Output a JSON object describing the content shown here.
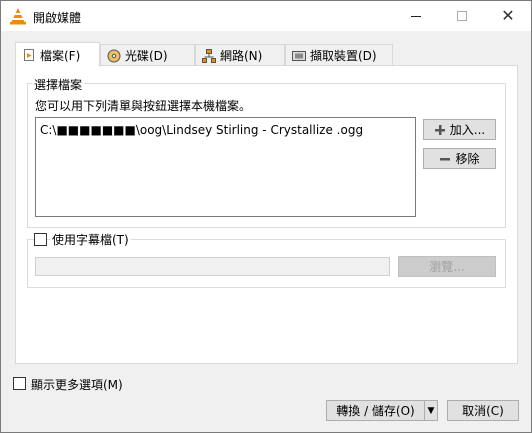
{
  "window": {
    "title": "開啟媒體",
    "minimize_icon": "minimize-icon",
    "maximize_icon": "maximize-icon",
    "close_icon": "close-icon",
    "close_glyph": "✕"
  },
  "tabs": [
    {
      "label": "檔案(F)",
      "icon": "file-icon",
      "active": true
    },
    {
      "label": "光碟(D)",
      "icon": "disc-icon",
      "active": false
    },
    {
      "label": "網路(N)",
      "icon": "network-icon",
      "active": false
    },
    {
      "label": "擷取裝置(D)",
      "icon": "capture-device-icon",
      "active": false
    }
  ],
  "file_selection": {
    "group_title": "選擇檔案",
    "hint": "您可以用下列清單與按鈕選擇本機檔案。",
    "files": [
      "C:\\■■■■■■■\\oog\\Lindsey Stirling - Crystallize .ogg"
    ],
    "add_button": "加入...",
    "remove_button": "移除"
  },
  "subtitle": {
    "checkbox_label": "使用字幕檔(T)",
    "checked": false,
    "path_value": "",
    "browse_button": "瀏覽..."
  },
  "footer": {
    "more_options_label": "顯示更多選項(M)",
    "more_options_checked": false,
    "convert_save_button": "轉換 / 儲存(O)",
    "cancel_button": "取消(C)"
  },
  "colors": {
    "window_bg": "#f0f0f0",
    "panel_bg": "#ffffff",
    "vlc_orange": "#f08c00"
  }
}
